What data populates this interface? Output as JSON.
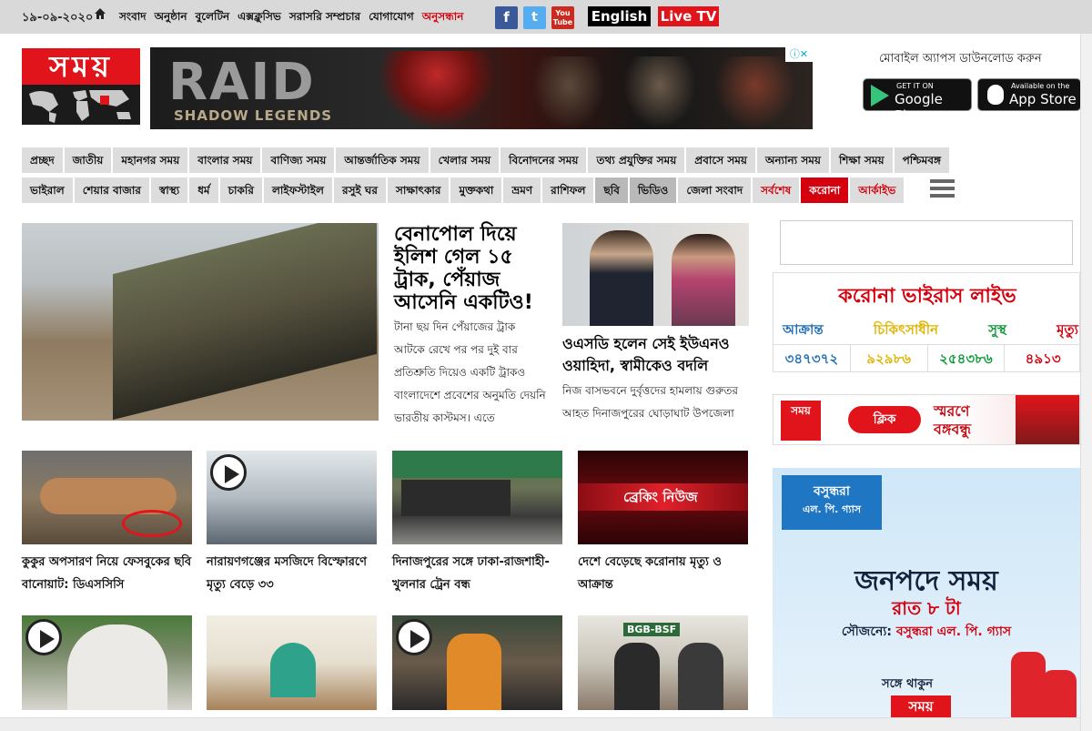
{
  "topbar": {
    "date": "১৯-০৯-২০২০",
    "nav": [
      "সংবাদ",
      "অনুষ্ঠান",
      "বুলেটিন",
      "এক্সক্লুসিভ",
      "সরাসরি সম্প্রচার",
      "যোগাযোগ",
      "অনুসন্ধান"
    ],
    "english": "English",
    "live_tv": "Live TV",
    "social": {
      "facebook": "f",
      "twitter": "t",
      "youtube": "You Tube"
    }
  },
  "header": {
    "logo_text": "সময়",
    "ad": {
      "title": "RAID",
      "subtitle": "SHADOW LEGENDS"
    },
    "app_download": "মোবাইল অ্যাপস ডাউনলোড করুন",
    "google_play": {
      "small": "GET IT ON",
      "big": "Google Play"
    },
    "app_store": {
      "small": "Available on the",
      "big": "App Store"
    }
  },
  "nav_row1": [
    "প্রচ্ছদ",
    "জাতীয়",
    "মহানগর সময়",
    "বাংলার সময়",
    "বাণিজ্য সময়",
    "আন্তর্জাতিক সময়",
    "খেলার সময়",
    "বিনোদনের সময়",
    "তথ্য প্রযুক্তির সময়",
    "প্রবাসে সময়",
    "অন্যান্য সময়",
    "শিক্ষা সময়",
    "পশ্চিমবঙ্গ"
  ],
  "nav_row2": [
    "ভাইরাল",
    "শেয়ার বাজার",
    "স্বাস্থ্য",
    "ধর্ম",
    "চাকরি",
    "লাইফস্টাইল",
    "রসুই ঘর",
    "সাক্ষাৎকার",
    "মুক্তকথা",
    "ভ্রমণ",
    "রাশিফল",
    "ছবি",
    "ভিডিও",
    "জেলা সংবাদ",
    "সর্বশেষ",
    "করোনা",
    "আর্কাইভ"
  ],
  "lead": {
    "title": "বেনাপোল দিয়ে ইলিশ গেল ১৫ ট্রাক, পেঁয়াজ আসেনি একটিও!",
    "summary": "টানা ছয় দিন পেঁয়াজের ট্রাক আটকে রেখে পর পর দুই বার প্রতিশ্রুতি দিয়েও একটি ট্রাকও বাংলাদেশে প্রবেশের অনুমতি দেয়নি ভারতীয় কাস্টমস। এতে"
  },
  "second": {
    "title": "ওএসডি হলেন সেই ইউএনও ওয়াহিদা, স্বামীকেও বদলি",
    "summary": "নিজ বাসভবনে দুর্বৃত্তদের হামলায় গুরুতর আহত দিনাজপুরের ঘোড়াঘাট উপজেলা"
  },
  "cards": [
    {
      "title": "কুকুর অপসারণ নিয়ে ফেসবুকের ছবি বানোয়াট: ডিএসসিসি"
    },
    {
      "title": "নারায়ণগঞ্জের মসজিদে বিস্ফোরণে মৃত্যু বেড়ে ৩৩"
    },
    {
      "title": "দিনাজপুরের সঙ্গে ঢাকা-রাজশাহী-খুলনার ট্রেন বন্ধ"
    },
    {
      "title": "দেশে বেড়েছে করোনায় মৃত্যু ও আক্রান্ত",
      "badge": "ব্রেকিং নিউজ"
    }
  ],
  "row2_images": [
    "BGB-BSF"
  ],
  "corona": {
    "title": "করোনা ভাইরাস লাইভ",
    "heads": [
      "আক্রান্ত",
      "চিকিৎসাধীন",
      "সুস্থ",
      "মৃত্যু"
    ],
    "values": [
      "৩৪৭৩৭২",
      "৯২৯৮৬",
      "২৫৪৩৮৬",
      "৪৯১৩"
    ],
    "colors": [
      "#1f6fb5",
      "#e0b400",
      "#0f9a3a",
      "#d4000d"
    ]
  },
  "smaran": {
    "logo": "সময়",
    "button": "ক্লিক",
    "text1": "স্মরণে",
    "text2": "বঙ্গবন্ধু"
  },
  "jonopode": {
    "brand": "বসুন্ধরা",
    "brand_sub": "এল. পি. গ্যাস",
    "title": "জনপদে সময়",
    "time": "রাত ৮ টা",
    "sponsor_label": "সৌজন্যে:",
    "sponsor": "বসুন্ধরা এল. পি. গ্যাস",
    "stay": "সঙ্গে থাকুন",
    "somoy": "সময়"
  }
}
